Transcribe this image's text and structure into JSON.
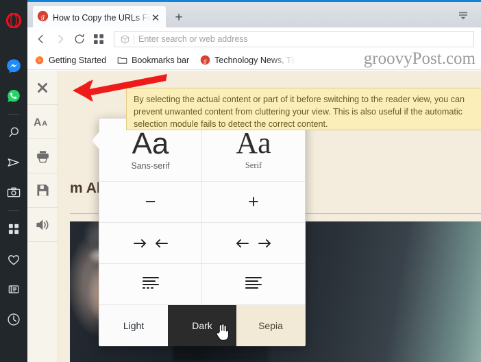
{
  "sidebar": {
    "items": [
      {
        "name": "opera-logo",
        "label": "Opera"
      },
      {
        "name": "messenger-icon",
        "label": "Messenger"
      },
      {
        "name": "whatsapp-icon",
        "label": "WhatsApp"
      },
      {
        "name": "separator-1",
        "label": ""
      },
      {
        "name": "search-icon",
        "label": "Search"
      },
      {
        "name": "send-icon",
        "label": "Send"
      },
      {
        "name": "snapshot-camera-icon",
        "label": "Snapshot"
      },
      {
        "name": "separator-2",
        "label": ""
      },
      {
        "name": "speed-dial-icon",
        "label": "Speed Dial"
      },
      {
        "name": "heart-icon",
        "label": "Bookmarks"
      },
      {
        "name": "news-icon",
        "label": "News"
      },
      {
        "name": "history-clock-icon",
        "label": "History"
      }
    ]
  },
  "titlebar": {
    "tab_title": "How to Copy the URLs Fro",
    "tab_close_glyph": "✕",
    "new_tab_glyph": "+",
    "tab_favicon_letter": "g",
    "tab_menu_name": "tab-list-menu"
  },
  "navbar": {
    "back_glyph": "‹",
    "forward_glyph": "›",
    "reload_name": "reload-icon",
    "speeddial_name": "speed-dial-icon",
    "address_badge": "page-badge-icon",
    "address_placeholder": "Enter search or web address",
    "address_value": ""
  },
  "bookmarks": [
    {
      "name": "bookmark-getting-started",
      "label": "Getting Started",
      "icon": "firefox-icon"
    },
    {
      "name": "bookmark-bookmarks-bar",
      "label": "Bookmarks bar",
      "icon": "folder-icon"
    },
    {
      "name": "bookmark-technology-news",
      "label": "Technology News, Tip",
      "icon": "groovypost-icon"
    }
  ],
  "watermark": {
    "text": "groovyPost.com"
  },
  "callout": {
    "text": "By selecting the actual content or part of it before switching to the reader view, you can prevent unwanted content from cluttering your view. This is also useful if the automatic selection module fails to detect the correct content."
  },
  "reader_toolbar": {
    "buttons": [
      {
        "name": "close-reader-view-button",
        "icon": "close-x-icon"
      },
      {
        "name": "font-settings-button",
        "icon": "font-aa-icon"
      },
      {
        "name": "print-button",
        "icon": "printer-icon"
      },
      {
        "name": "save-button",
        "icon": "floppy-disk-icon"
      },
      {
        "name": "read-aloud-button",
        "icon": "speaker-icon"
      }
    ]
  },
  "reader_popup": {
    "fonts": [
      {
        "name": "font-sans-serif-option",
        "sample": "Aa",
        "label": "Sans-serif"
      },
      {
        "name": "font-serif-option",
        "sample": "Aa",
        "label": "Serif"
      }
    ],
    "size": [
      {
        "name": "font-size-decrease-button",
        "glyph": "−"
      },
      {
        "name": "font-size-increase-button",
        "glyph": "+"
      }
    ],
    "width": [
      {
        "name": "column-width-narrow-button",
        "glyphs": "→ ←"
      },
      {
        "name": "column-width-wide-button",
        "glyphs": "← →"
      }
    ],
    "spacing": [
      {
        "name": "line-spacing-compact-button",
        "icon": "line-spacing-compact-icon"
      },
      {
        "name": "line-spacing-wide-button",
        "icon": "line-spacing-wide-icon"
      }
    ],
    "themes": [
      {
        "name": "theme-light-button",
        "label": "Light",
        "bg": "#fbfbfb",
        "fg": "#2c3136"
      },
      {
        "name": "theme-dark-button",
        "label": "Dark",
        "bg": "#2b2b2b",
        "fg": "#f2f2f2"
      },
      {
        "name": "theme-sepia-button",
        "label": "Sepia",
        "bg": "#f2e9d7",
        "fg": "#4e4434"
      }
    ]
  },
  "article": {
    "title": "m All Open Tabs in Your Brows",
    "hero_photo_name": "article-hero-photo"
  },
  "annotation": {
    "arrow_color": "#ee1b1b",
    "arrow_name": "red-annotation-arrow"
  },
  "colors": {
    "sidebar_bg": "#22272b",
    "reader_sepia_bg": "#f4ecdc",
    "callout_bg": "#fbeeb8",
    "callout_border": "#e0cd86",
    "accent_blue": "#0f84d8"
  }
}
